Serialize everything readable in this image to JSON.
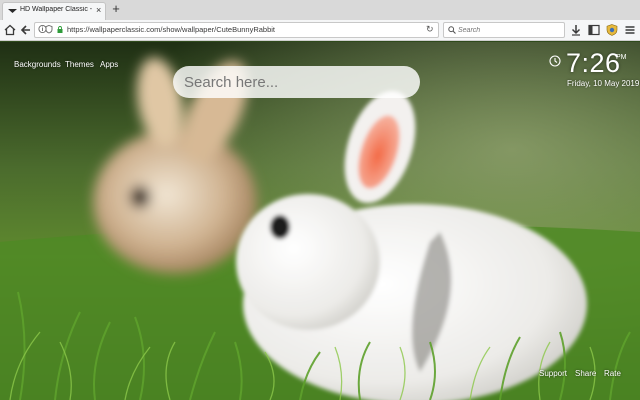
{
  "browser": {
    "tab_title": "HD Wallpaper Classic - Cute",
    "tab_close": "×",
    "new_tab": "+",
    "url": "https://wallpaperclassic.com/show/wallpaper/CuteBunnyRabbit",
    "search_placeholder": "Search",
    "reload": "↻"
  },
  "nav": {
    "backgrounds": "Backgrounds",
    "themes": "Themes",
    "apps": "Apps"
  },
  "search": {
    "placeholder": "Search here..."
  },
  "clock": {
    "time": "7:26",
    "ampm": "PM",
    "date": "Friday, 10 May 2019"
  },
  "footer": {
    "support": "Support",
    "share": "Share",
    "rate": "Rate"
  },
  "icons": [
    "home-icon",
    "back-icon",
    "info-icon",
    "lock-icon",
    "reload-icon",
    "search-icon",
    "download-icon",
    "sidebar-icon",
    "extension-icon",
    "menu-icon",
    "clock-icon"
  ],
  "colors": {
    "accent": "#ffffff",
    "grass": "#3f7a22"
  }
}
